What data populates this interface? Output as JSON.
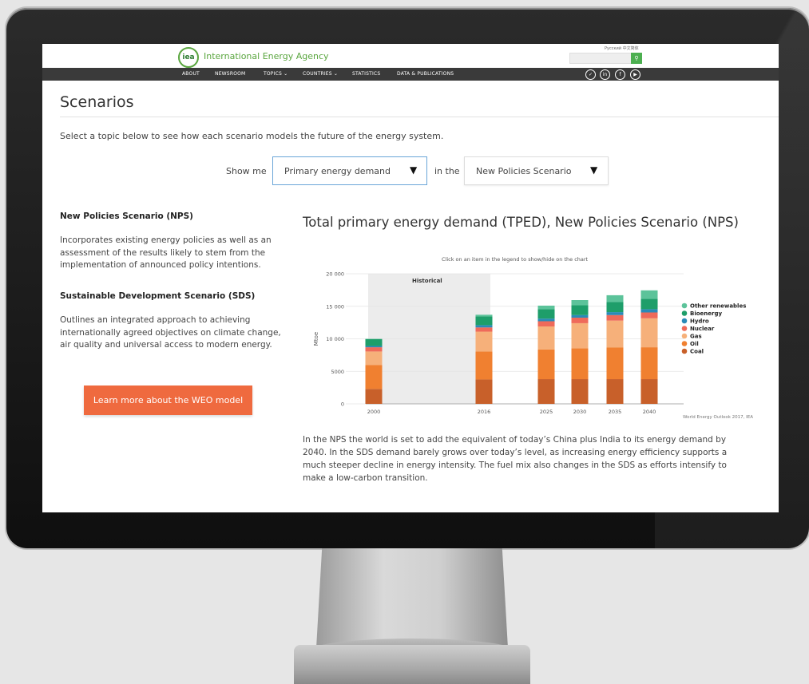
{
  "site": {
    "agency_name": "International Energy Agency",
    "logo_text": "iea",
    "lang_links": "Pусский   中文简体",
    "search_icon": "search-icon",
    "nav": [
      "ABOUT",
      "NEWSROOM",
      "TOPICS ⌄",
      "COUNTRIES ⌄",
      "STATISTICS",
      "DATA & PUBLICATIONS"
    ],
    "social": [
      "twitter-icon",
      "linkedin-icon",
      "facebook-icon",
      "youtube-icon"
    ],
    "social_glyphs": [
      "✓",
      "in",
      "f",
      "▶"
    ]
  },
  "page": {
    "title": "Scenarios",
    "intro": "Select a topic below to see how each scenario models the future of the energy system.",
    "show_me": "Show me",
    "dropdown_topic": "Primary energy demand",
    "in_the": "in the",
    "dropdown_scenario": "New Policies Scenario",
    "dropdown_arrow": "▼"
  },
  "sidebar": {
    "nps_heading": "New Policies Scenario (NPS)",
    "nps_text": "Incorporates existing energy policies as well as an assessment of the results likely to stem from the implementation of announced policy intentions.",
    "sds_heading": "Sustainable Development Scenario (SDS)",
    "sds_text": "Outlines an integrated approach to achieving internationally agreed objectives on climate change, air quality and universal access to modern energy.",
    "learn_more": "Learn more about the WEO model"
  },
  "chart_section": {
    "title": "Total primary energy demand (TPED), New Policies Scenario (NPS)",
    "note": "Click on an item in the legend to show/hide on the chart",
    "source": "World Energy Outlook 2017, IEA",
    "paragraph": "In the NPS the world is set to add the equivalent of today’s China plus India to its energy demand by 2040. In the SDS demand barely grows over today’s level, as increasing energy efficiency supports a much steeper decline in energy intensity. The fuel mix also changes in the SDS as efforts intensify to make a low-carbon transition."
  },
  "chart_data": {
    "type": "bar",
    "stacked": true,
    "ylabel": "Mtoe",
    "ylim": [
      0,
      20000
    ],
    "yticks": [
      0,
      5000,
      10000,
      15000,
      20000
    ],
    "ytick_labels": [
      "0",
      "5000",
      "10 000",
      "15 000",
      "20 000"
    ],
    "categories": [
      "2000",
      "2016",
      "2025",
      "2030",
      "2035",
      "2040"
    ],
    "historical_label": "Historical",
    "historical_categories": [
      "2000",
      "2016"
    ],
    "legend_position": "right",
    "series": [
      {
        "name": "Coal",
        "color": "#c8602a",
        "values": [
          2300,
          3750,
          3800,
          3800,
          3800,
          3800
        ]
      },
      {
        "name": "Oil",
        "color": "#f08030",
        "values": [
          3650,
          4300,
          4550,
          4750,
          4850,
          4900
        ]
      },
      {
        "name": "Gas",
        "color": "#f6b07a",
        "values": [
          2100,
          3050,
          3550,
          3850,
          4150,
          4450
        ]
      },
      {
        "name": "Nuclear",
        "color": "#ef6a5a",
        "values": [
          650,
          650,
          800,
          850,
          850,
          900
        ]
      },
      {
        "name": "Hydro",
        "color": "#2a8ab8",
        "values": [
          200,
          350,
          400,
          400,
          450,
          500
        ]
      },
      {
        "name": "Bioenergy",
        "color": "#1e9e6a",
        "values": [
          1050,
          1350,
          1450,
          1500,
          1550,
          1600
        ]
      },
      {
        "name": "Other renewables",
        "color": "#5cc39a",
        "values": [
          50,
          250,
          550,
          800,
          1050,
          1300
        ]
      }
    ]
  }
}
